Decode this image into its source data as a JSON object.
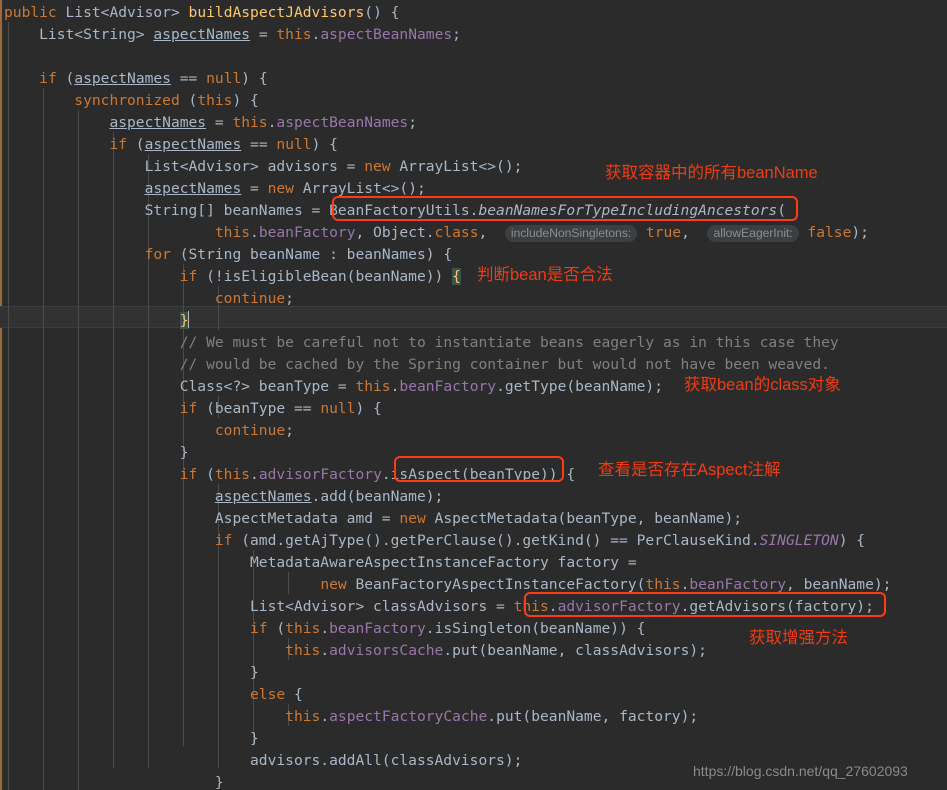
{
  "editor": {
    "language": "java",
    "theme": "darcula",
    "background": "#2b2b2b",
    "current_line_background": "#323232",
    "default_text_color": "#a9b7c6"
  },
  "code": {
    "lines": [
      {
        "indent": 0,
        "text": "public List<Advisor> buildAspectJAdvisors() {"
      },
      {
        "indent": 1,
        "text": "List<String> aspectNames = this.aspectBeanNames;"
      },
      {
        "indent": 0,
        "text": ""
      },
      {
        "indent": 1,
        "text": "if (aspectNames == null) {"
      },
      {
        "indent": 2,
        "text": "synchronized (this) {"
      },
      {
        "indent": 3,
        "text": "aspectNames = this.aspectBeanNames;"
      },
      {
        "indent": 3,
        "text": "if (aspectNames == null) {"
      },
      {
        "indent": 4,
        "text": "List<Advisor> advisors = new ArrayList<>();"
      },
      {
        "indent": 4,
        "text": "aspectNames = new ArrayList<>();"
      },
      {
        "indent": 4,
        "text": "String[] beanNames = BeanFactoryUtils.beanNamesForTypeIncludingAncestors("
      },
      {
        "indent": 6,
        "text": "this.beanFactory, Object.class, includeNonSingletons: true,  allowEagerInit: false);"
      },
      {
        "indent": 4,
        "text": "for (String beanName : beanNames) {"
      },
      {
        "indent": 5,
        "text": "if (!isEligibleBean(beanName)) {"
      },
      {
        "indent": 6,
        "text": "continue;"
      },
      {
        "indent": 5,
        "text": "}"
      },
      {
        "indent": 5,
        "text": "// We must be careful not to instantiate beans eagerly as in this case they"
      },
      {
        "indent": 5,
        "text": "// would be cached by the Spring container but would not have been weaved."
      },
      {
        "indent": 5,
        "text": "Class<?> beanType = this.beanFactory.getType(beanName);"
      },
      {
        "indent": 5,
        "text": "if (beanType == null) {"
      },
      {
        "indent": 6,
        "text": "continue;"
      },
      {
        "indent": 5,
        "text": "}"
      },
      {
        "indent": 5,
        "text": "if (this.advisorFactory.isAspect(beanType)) {"
      },
      {
        "indent": 6,
        "text": "aspectNames.add(beanName);"
      },
      {
        "indent": 6,
        "text": "AspectMetadata amd = new AspectMetadata(beanType, beanName);"
      },
      {
        "indent": 6,
        "text": "if (amd.getAjType().getPerClause().getKind() == PerClauseKind.SINGLETON) {"
      },
      {
        "indent": 7,
        "text": "MetadataAwareAspectInstanceFactory factory ="
      },
      {
        "indent": 9,
        "text": "new BeanFactoryAspectInstanceFactory(this.beanFactory, beanName);"
      },
      {
        "indent": 7,
        "text": "List<Advisor> classAdvisors = this.advisorFactory.getAdvisors(factory);"
      },
      {
        "indent": 7,
        "text": "if (this.beanFactory.isSingleton(beanName)) {"
      },
      {
        "indent": 8,
        "text": "this.advisorsCache.put(beanName, classAdvisors);"
      },
      {
        "indent": 7,
        "text": "}"
      },
      {
        "indent": 7,
        "text": "else {"
      },
      {
        "indent": 8,
        "text": "this.aspectFactoryCache.put(beanName, factory);"
      },
      {
        "indent": 7,
        "text": "}"
      },
      {
        "indent": 7,
        "text": "advisors.addAll(classAdvisors);"
      },
      {
        "indent": 6,
        "text": "}"
      }
    ],
    "parameter_hints": [
      {
        "label": "includeNonSingletons:",
        "value": "true"
      },
      {
        "label": "allowEagerInit:",
        "value": "false"
      }
    ],
    "current_line_number": 15,
    "matched_brace": "}"
  },
  "annotations": {
    "boxes": [
      {
        "id": "box-bean-names-for-type",
        "target": "BeanFactoryUtils.beanNamesForTypeIncludingAncestors("
      },
      {
        "id": "box-is-aspect",
        "target": "isAspect(beanType)"
      },
      {
        "id": "box-get-advisors",
        "target": "this.advisorFactory.getAdvisors(factory)"
      }
    ],
    "notes": [
      {
        "id": "note-get-all-bean-names",
        "text": "获取容器中的所有beanName"
      },
      {
        "id": "note-check-bean-legal",
        "text": "判断bean是否合法"
      },
      {
        "id": "note-get-bean-class",
        "text": "获取bean的class对象"
      },
      {
        "id": "note-check-aspect-annotation",
        "text": "查看是否存在Aspect注解"
      },
      {
        "id": "note-get-advice-methods",
        "text": "获取增强方法"
      }
    ],
    "color": "#f03c12"
  },
  "watermark": {
    "text": "https://blog.csdn.net/qq_27602093"
  }
}
